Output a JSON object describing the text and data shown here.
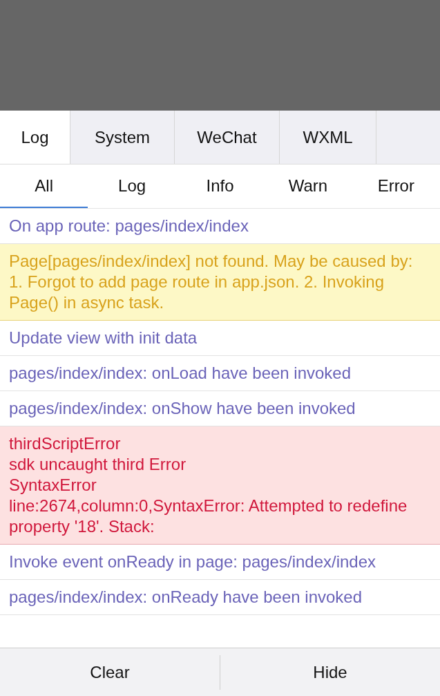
{
  "tabs": [
    {
      "label": "Log",
      "selected": true
    },
    {
      "label": "System",
      "selected": false
    },
    {
      "label": "WeChat",
      "selected": false
    },
    {
      "label": "WXML",
      "selected": false
    }
  ],
  "filters": [
    {
      "label": "All",
      "selected": true
    },
    {
      "label": "Log",
      "selected": false
    },
    {
      "label": "Info",
      "selected": false
    },
    {
      "label": "Warn",
      "selected": false
    },
    {
      "label": "Error",
      "selected": false
    }
  ],
  "entries": [
    {
      "kind": "log",
      "lines": [
        "On app route: pages/index/index"
      ]
    },
    {
      "kind": "warn",
      "lines": [
        "Page[pages/index/index] not found. May be caused by: 1. Forgot to add page route in app.json. 2. Invoking Page() in async task."
      ]
    },
    {
      "kind": "log",
      "lines": [
        "Update view with init data"
      ]
    },
    {
      "kind": "log",
      "lines": [
        "pages/index/index: onLoad have been invoked"
      ]
    },
    {
      "kind": "log",
      "lines": [
        "pages/index/index: onShow have been invoked"
      ]
    },
    {
      "kind": "error",
      "lines": [
        "thirdScriptError",
        "sdk uncaught third Error",
        "SyntaxError",
        "line:2674,column:0,SyntaxError: Attempted to redefine property '18'. Stack:"
      ]
    },
    {
      "kind": "log",
      "lines": [
        "Invoke event onReady in page: pages/index/index"
      ]
    },
    {
      "kind": "log",
      "lines": [
        "pages/index/index: onReady have been invoked"
      ]
    }
  ],
  "buttons": [
    "Clear",
    "Hide"
  ]
}
